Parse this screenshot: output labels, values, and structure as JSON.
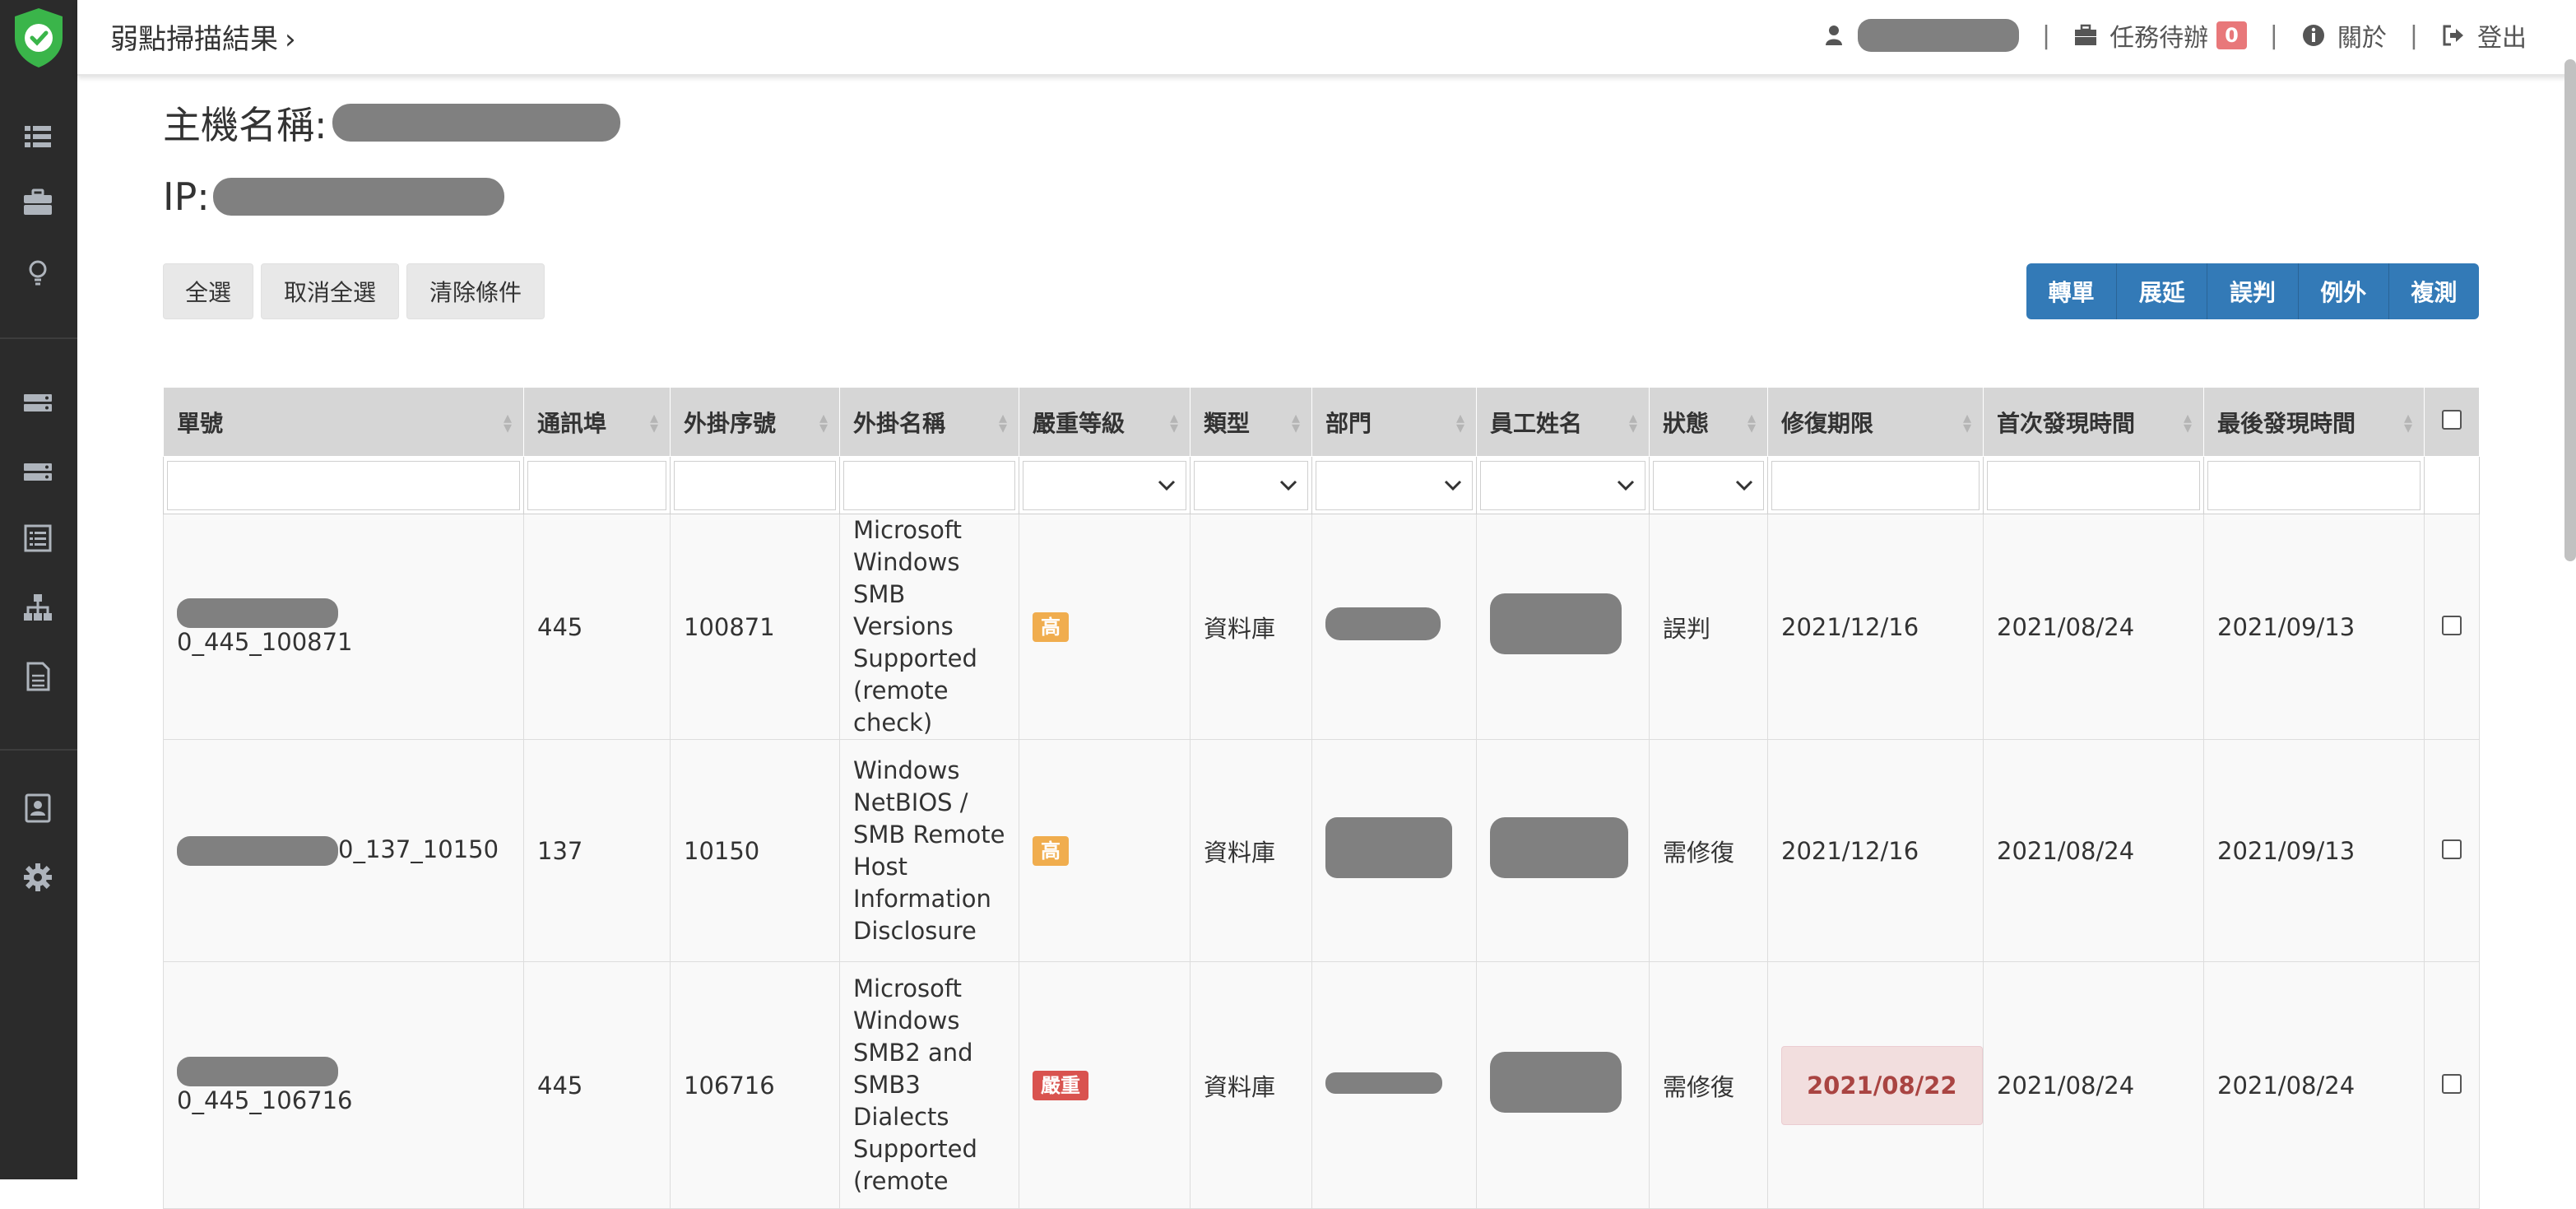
{
  "header": {
    "breadcrumb": "弱點掃描結果",
    "breadcrumb_chevron": "›",
    "tasks_label": "任務待辦",
    "tasks_count": "0",
    "about_label": "關於",
    "logout_label": "登出",
    "separator": "|"
  },
  "host": {
    "name_label": "主機名稱:",
    "ip_label": "IP:"
  },
  "toolbar": {
    "select_all": "全選",
    "deselect_all": "取消全選",
    "clear_filters": "清除條件",
    "actions": [
      "轉單",
      "展延",
      "誤判",
      "例外",
      "複測"
    ]
  },
  "table": {
    "columns": [
      "單號",
      "通訊埠",
      "外掛序號",
      "外掛名稱",
      "嚴重等級",
      "類型",
      "部門",
      "員工姓名",
      "狀態",
      "修復期限",
      "首次發現時間",
      "最後發現時間"
    ],
    "rows": [
      {
        "ticket_suffix": "0_445_100871",
        "port": "445",
        "plugin_id": "100871",
        "plugin_name": [
          "Microsoft",
          "Windows",
          "SMB Versions",
          "Supported",
          "(remote",
          "check)"
        ],
        "severity": "高",
        "type": "資料庫",
        "status": "誤判",
        "due": "2021/12/16",
        "first_seen": "2021/08/24",
        "last_seen": "2021/09/13"
      },
      {
        "ticket_suffix": "0_137_10150",
        "port": "137",
        "plugin_id": "10150",
        "plugin_name": [
          "Windows",
          "NetBIOS /",
          "SMB Remote",
          "Host",
          "Information",
          "Disclosure"
        ],
        "severity": "高",
        "type": "資料庫",
        "status": "需修復",
        "due": "2021/12/16",
        "first_seen": "2021/08/24",
        "last_seen": "2021/09/13"
      },
      {
        "ticket_suffix": "0_445_106716",
        "port": "445",
        "plugin_id": "106716",
        "plugin_name": [
          "Microsoft",
          "Windows",
          "SMB2 and",
          "SMB3",
          "Dialects",
          "Supported",
          "(remote"
        ],
        "severity": "嚴重",
        "type": "資料庫",
        "status": "需修復",
        "due": "2021/08/22",
        "first_seen": "2021/08/24",
        "last_seen": "2021/08/24"
      }
    ]
  },
  "colors": {
    "sidebar_bg": "#2b2b2b",
    "primary": "#337ab7",
    "severity_high": "#f0ad4e",
    "severity_critical": "#d9534f",
    "overdue_bg": "#f2dede",
    "overdue_text": "#a94442",
    "logo_green": "#3ab54a"
  },
  "icons": {
    "sidebar": [
      "list-icon",
      "briefcase-icon",
      "lightbulb-icon",
      "server-icon",
      "server-stack-icon",
      "report-list-icon",
      "sitemap-icon",
      "document-icon",
      "contact-card-icon",
      "gear-icon"
    ],
    "header": [
      "user-icon",
      "briefcase-icon",
      "info-icon",
      "logout-icon"
    ]
  }
}
